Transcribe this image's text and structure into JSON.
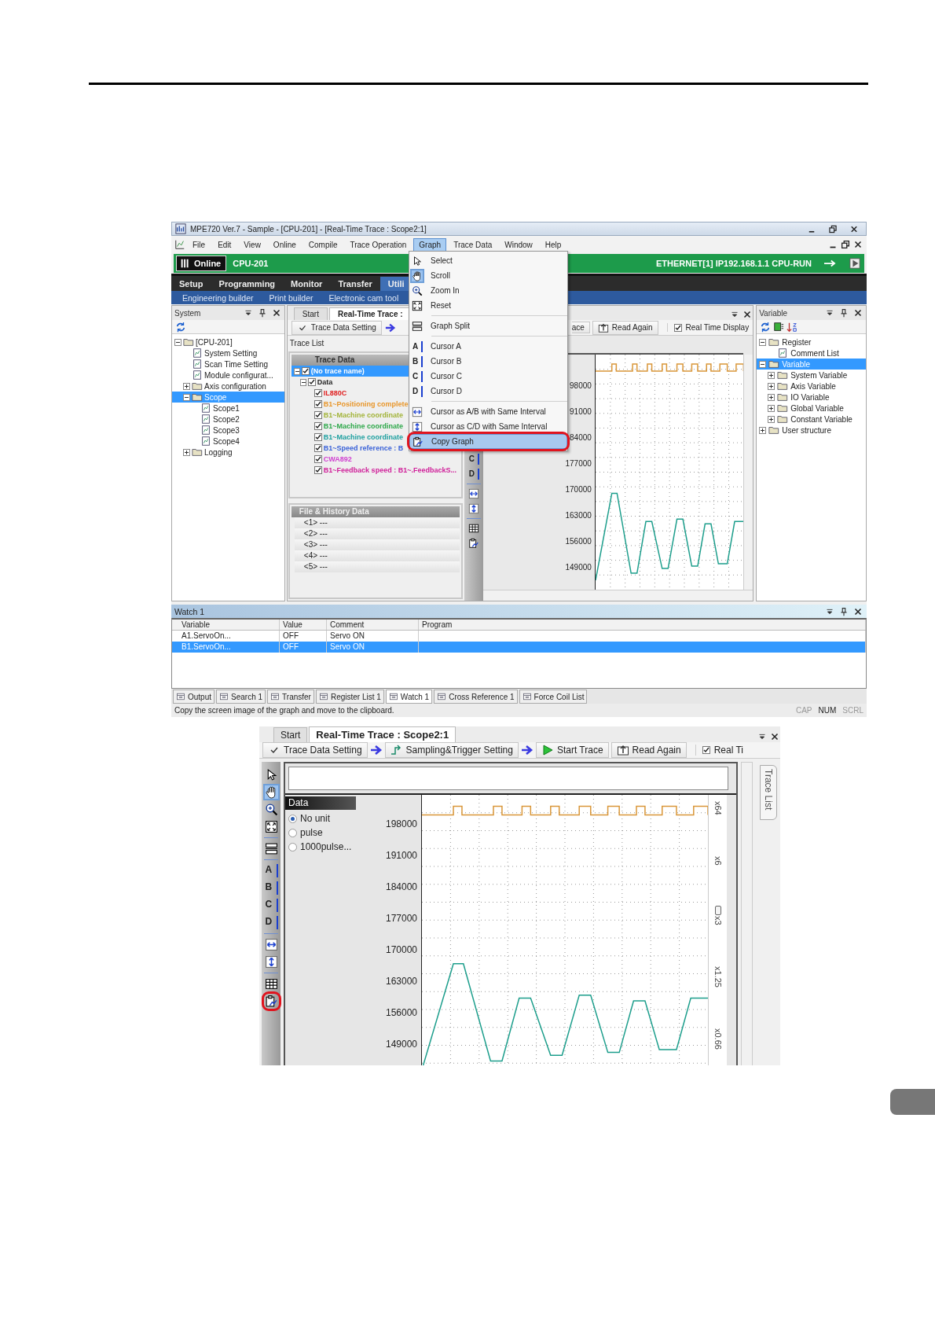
{
  "main_window": {
    "title": "MPE720 Ver.7 - Sample - [CPU-201] - [Real-Time Trace : Scope2:1]",
    "menu": [
      {
        "label": "File",
        "selected": false
      },
      {
        "label": "Edit",
        "selected": false
      },
      {
        "label": "View",
        "selected": false
      },
      {
        "label": "Online",
        "selected": false
      },
      {
        "label": "Compile",
        "selected": false
      },
      {
        "label": "Trace Operation",
        "selected": false
      },
      {
        "label": "Graph",
        "selected": true
      },
      {
        "label": "Trace Data",
        "selected": false
      },
      {
        "label": "Window",
        "selected": false
      },
      {
        "label": "Help",
        "selected": false
      }
    ],
    "connection": {
      "mode": "Online",
      "cpu": "CPU-201",
      "status": "ETHERNET[1] IP192.168.1.1 CPU-RUN"
    },
    "ribbon_tabs": [
      {
        "label": "Setup",
        "selected": false
      },
      {
        "label": "Programming",
        "selected": false
      },
      {
        "label": "Monitor",
        "selected": false
      },
      {
        "label": "Transfer",
        "selected": false
      },
      {
        "label": "Utili",
        "selected": true
      }
    ],
    "ribbon_items": [
      "Engineering builder",
      "Print builder",
      "Electronic cam tool"
    ],
    "system_panel": {
      "title": "System",
      "tree": [
        {
          "label": "[CPU-201]",
          "expanded": true,
          "selected": false,
          "children": [
            {
              "label": "System Setting",
              "selected": false
            },
            {
              "label": "Scan Time Setting",
              "selected": false
            },
            {
              "label": "Module configurat...",
              "selected": false
            },
            {
              "label": "Axis configuration",
              "expanded": false,
              "selected": false
            },
            {
              "label": "Scope",
              "expanded": true,
              "selected": true,
              "children": [
                {
                  "label": "Scope1",
                  "selected": false
                },
                {
                  "label": "Scope2",
                  "selected": false
                },
                {
                  "label": "Scope3",
                  "selected": false
                },
                {
                  "label": "Scope4",
                  "selected": false
                }
              ]
            },
            {
              "label": "Logging",
              "expanded": false,
              "selected": false
            }
          ]
        }
      ]
    },
    "trace_panel": {
      "tabs": [
        {
          "label": "Start",
          "selected": false
        },
        {
          "label": "Real-Time Trace :",
          "selected": true
        }
      ],
      "toolbar": [
        {
          "kind": "setting",
          "label": "Trace Data Setting"
        },
        {
          "kind": "arrow"
        },
        {
          "kind": "partial",
          "label": "ace"
        },
        {
          "kind": "read",
          "label": "Read Again"
        }
      ],
      "real_time": {
        "label": "Real Time Display",
        "checked": true
      },
      "trace_list": {
        "title": "Trace List",
        "header": "Trace Data",
        "tree": [
          {
            "label": "(No trace name)",
            "checked": true,
            "expanded": true,
            "selected": true,
            "children": [
              {
                "label": "Data",
                "checked": true,
                "expanded": true,
                "selected": false,
                "children": [
                  {
                    "label": "IL880C",
                    "checked": true,
                    "color": "#e02020"
                  },
                  {
                    "label": "B1~Positioning complete",
                    "checked": true,
                    "color": "#e8962a"
                  },
                  {
                    "label": "B1~Machine coordinate",
                    "checked": true,
                    "color": "#a3b43a"
                  },
                  {
                    "label": "B1~Machine coordinate",
                    "checked": true,
                    "color": "#2ea84a"
                  },
                  {
                    "label": "B1~Machine coordinate",
                    "checked": true,
                    "color": "#1fa0a0"
                  },
                  {
                    "label": "B1~Speed reference : B",
                    "checked": true,
                    "color": "#3a62d8"
                  },
                  {
                    "label": "CWA892",
                    "checked": true,
                    "color": "#d040d0"
                  },
                  {
                    "label": "B1~Feedback speed : B1~.FeedbackS...",
                    "checked": true,
                    "color": "#d0209a"
                  }
                ]
              }
            ]
          }
        ]
      },
      "history": {
        "header": "File & History Data",
        "rows": [
          "<1> ---",
          "<2> ---",
          "<3> ---",
          "<4> ---",
          "<5> ---"
        ]
      },
      "tools": [
        {
          "kind": "cursor",
          "glyph": "C"
        },
        {
          "kind": "cursor",
          "glyph": "D"
        },
        {
          "kind": "separator"
        },
        {
          "kind": "interval-h"
        },
        {
          "kind": "interval-v"
        },
        {
          "kind": "separator"
        },
        {
          "kind": "table"
        },
        {
          "kind": "copy"
        }
      ],
      "y_labels": [
        "98000",
        "91000",
        "84000",
        "177000",
        "170000",
        "163000",
        "156000",
        "149000"
      ]
    },
    "graph_menu": {
      "items": [
        {
          "kind": "select",
          "label": "Select",
          "checked": false,
          "highlighted": false,
          "circled": false
        },
        {
          "kind": "scroll",
          "label": "Scroll",
          "checked": true,
          "highlighted": false,
          "circled": false
        },
        {
          "kind": "zoom",
          "label": "Zoom In",
          "checked": false,
          "highlighted": false,
          "circled": false
        },
        {
          "kind": "reset",
          "label": "Reset",
          "checked": false,
          "highlighted": false,
          "circled": false
        },
        {
          "kind": "separator"
        },
        {
          "kind": "split",
          "label": "Graph Split",
          "checked": false,
          "highlighted": false,
          "circled": false
        },
        {
          "kind": "separator"
        },
        {
          "kind": "cursor",
          "glyph": "A",
          "label": "Cursor A",
          "highlighted": false,
          "circled": false
        },
        {
          "kind": "cursor",
          "glyph": "B",
          "label": "Cursor B",
          "highlighted": false,
          "circled": false
        },
        {
          "kind": "cursor",
          "glyph": "C",
          "label": "Cursor C",
          "highlighted": false,
          "circled": false
        },
        {
          "kind": "cursor",
          "glyph": "D",
          "label": "Cursor D",
          "highlighted": false,
          "circled": false
        },
        {
          "kind": "separator"
        },
        {
          "kind": "interval-h",
          "label": "Cursor as A/B with Same Interval",
          "checked": false,
          "highlighted": false,
          "circled": false
        },
        {
          "kind": "interval-v",
          "label": "Cursor as C/D with Same Interval",
          "checked": false,
          "highlighted": false,
          "circled": false
        },
        {
          "kind": "copy",
          "label": "Copy Graph",
          "checked": false,
          "highlighted": true,
          "circled": true
        }
      ]
    },
    "variable_panel": {
      "title": "Variable",
      "tree": [
        {
          "label": "Register",
          "expanded": true,
          "selected": false,
          "children": [
            {
              "label": "Comment List",
              "selected": false
            }
          ]
        },
        {
          "label": "Variable",
          "expanded": true,
          "selected": true,
          "children": [
            {
              "label": "System Variable",
              "expanded": false,
              "selected": false
            },
            {
              "label": "Axis Variable",
              "expanded": false,
              "selected": false
            },
            {
              "label": "IO Variable",
              "expanded": false,
              "selected": false
            },
            {
              "label": "Global Variable",
              "expanded": false,
              "selected": false
            },
            {
              "label": "Constant Variable",
              "expanded": false,
              "selected": false
            }
          ]
        },
        {
          "label": "User structure",
          "expanded": false,
          "selected": false
        }
      ]
    },
    "watch": {
      "title": "Watch 1",
      "columns": [
        "Variable",
        "Value",
        "Comment",
        "Program"
      ],
      "rows": [
        {
          "cells": [
            "A1.ServoOn...",
            "OFF",
            "Servo ON"
          ],
          "selected": false
        },
        {
          "cells": [
            "B1.ServoOn...",
            "OFF",
            "Servo ON"
          ],
          "selected": true
        }
      ]
    },
    "bottom_tabs": [
      {
        "label": "Output",
        "selected": false
      },
      {
        "label": "Search 1",
        "selected": false
      },
      {
        "label": "Transfer",
        "selected": false
      },
      {
        "label": "Register List 1",
        "selected": false
      },
      {
        "label": "Watch 1",
        "selected": true
      },
      {
        "label": "Cross Reference 1",
        "selected": false
      },
      {
        "label": "Force Coil List",
        "selected": false
      }
    ],
    "status_bar": {
      "message": "Copy the screen image of the graph and move to the clipboard.",
      "indicators": [
        {
          "label": "CAP",
          "on": false
        },
        {
          "label": "NUM",
          "on": true
        },
        {
          "label": "SCRL",
          "on": false
        }
      ]
    }
  },
  "zoom_window": {
    "tabs": [
      {
        "label": "Start",
        "selected": false
      },
      {
        "label": "Real-Time Trace : Scope2:1",
        "selected": true
      }
    ],
    "toolbar": [
      {
        "kind": "setting",
        "label": "Trace Data Setting"
      },
      {
        "kind": "arrow"
      },
      {
        "kind": "sampling",
        "label": "Sampling&Trigger Setting"
      },
      {
        "kind": "arrow"
      },
      {
        "kind": "start",
        "label": "Start Trace"
      },
      {
        "kind": "read",
        "label": "Read Again"
      }
    ],
    "real_time": {
      "label": "Real Ti",
      "checked": true
    },
    "side_tab": "Trace List",
    "tools": [
      {
        "kind": "select",
        "checked": false,
        "circled": false
      },
      {
        "kind": "scroll",
        "checked": true,
        "circled": false
      },
      {
        "kind": "zoom",
        "checked": false,
        "circled": false
      },
      {
        "kind": "reset",
        "checked": false,
        "circled": false
      },
      {
        "kind": "separator"
      },
      {
        "kind": "split",
        "checked": false,
        "circled": false
      },
      {
        "kind": "separator"
      },
      {
        "kind": "cursor",
        "glyph": "A"
      },
      {
        "kind": "cursor",
        "glyph": "B"
      },
      {
        "kind": "cursor",
        "glyph": "C"
      },
      {
        "kind": "cursor",
        "glyph": "D"
      },
      {
        "kind": "separator"
      },
      {
        "kind": "interval-h",
        "checked": false,
        "circled": false
      },
      {
        "kind": "interval-v",
        "checked": false,
        "circled": false
      },
      {
        "kind": "separator"
      },
      {
        "kind": "table",
        "checked": false,
        "circled": false
      },
      {
        "kind": "copy",
        "checked": false,
        "circled": true
      }
    ],
    "legend": {
      "title": "Data",
      "units": [
        {
          "label": "No unit",
          "selected": true
        },
        {
          "label": "pulse",
          "selected": false
        },
        {
          "label": "1000pulse...",
          "selected": false
        }
      ]
    },
    "y_labels": [
      "198000",
      "191000",
      "184000",
      "177000",
      "170000",
      "163000",
      "156000",
      "149000"
    ],
    "scales": [
      {
        "label": "x64",
        "handle": false
      },
      {
        "label": "x6",
        "handle": false
      },
      {
        "label": "x3",
        "handle": true
      },
      {
        "label": "x1.25",
        "handle": false
      },
      {
        "label": "x0.66",
        "handle": false
      }
    ]
  }
}
